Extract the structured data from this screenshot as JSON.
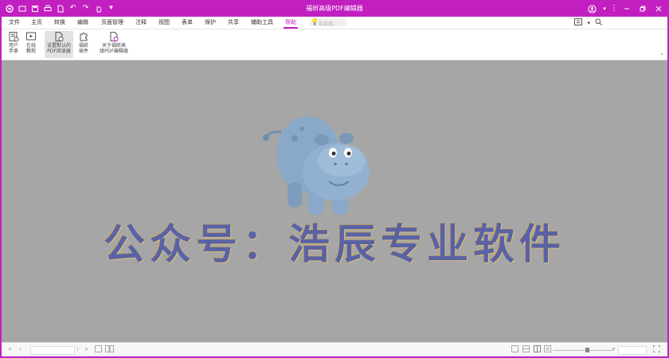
{
  "app": {
    "title": "福昕高级PDF编辑器",
    "brand_color": "#c21fc0"
  },
  "quick_access": [
    {
      "name": "app-logo-icon",
      "glyph": "◐"
    },
    {
      "name": "open-icon",
      "glyph": "▭"
    },
    {
      "name": "save-icon",
      "glyph": "▭"
    },
    {
      "name": "print-icon",
      "glyph": "▭"
    },
    {
      "name": "new-doc-icon",
      "glyph": "▭"
    },
    {
      "name": "undo-icon",
      "glyph": "↶"
    },
    {
      "name": "redo-icon",
      "glyph": "↷"
    },
    {
      "name": "hand-tool-icon",
      "glyph": "☜"
    },
    {
      "name": "customize-icon",
      "glyph": "▾"
    }
  ],
  "menu": {
    "items": [
      "文件",
      "主页",
      "转换",
      "编辑",
      "页面管理",
      "注释",
      "视图",
      "表单",
      "保护",
      "共享",
      "辅助工具",
      "帮助"
    ],
    "active": "帮助",
    "search_placeholder": "告诉我..."
  },
  "ribbon": {
    "buttons": [
      {
        "line1": "用户",
        "line2": "手册"
      },
      {
        "line1": "在线",
        "line2": "教程"
      },
      {
        "line1": "设置默认的",
        "line2": "PDF阅读器"
      },
      {
        "line1": "福昕",
        "line2": "插件"
      },
      {
        "line1": "关于福昕高",
        "line2": "级PDF编辑器"
      }
    ]
  },
  "document": {
    "watermark": "公众号：浩辰专业软件"
  }
}
